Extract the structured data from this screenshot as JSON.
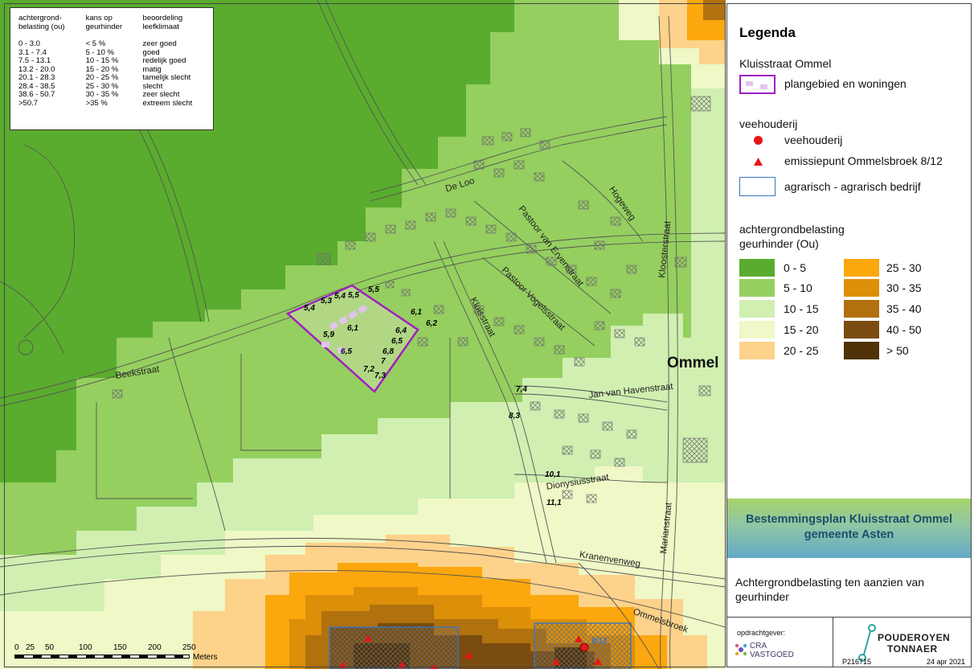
{
  "class_table": {
    "headers": [
      "achtergrond-\nbelasting (ou)",
      "kans op\ngeurhinder",
      "beoordeling\nleefklimaat"
    ],
    "rows": [
      [
        "0 - 3.0",
        "< 5 %",
        "zeer goed"
      ],
      [
        "3.1 - 7.4",
        "5 - 10 %",
        "goed"
      ],
      [
        "7.5 - 13.1",
        "10 - 15 %",
        "redelijk goed"
      ],
      [
        "13.2 - 20.0",
        "15 - 20 %",
        "matig"
      ],
      [
        "20.1 - 28.3",
        "20 - 25 %",
        "tamelijk slecht"
      ],
      [
        "28.4 - 38.5",
        "25 - 30 %",
        "slecht"
      ],
      [
        "38.6 - 50.7",
        "30 - 35 %",
        "zeer slecht"
      ],
      [
        ">50.7",
        ">35  %",
        "extreem slecht"
      ]
    ]
  },
  "streets": {
    "de_loo": "De Loo",
    "pastoor_van_erven": "Pastoor van Ervenstraat",
    "hogeweg": "Hogeweg",
    "kloosterstraat": "Kloosterstraat",
    "pastoor_vogels": "Pastoor Vogelsstraat",
    "kluisstraat": "Kluisstraat",
    "beekstraat": "Beekstraat",
    "jan_van_haven": "Jan van Havenstraat",
    "dionysius": "Dionysiusstraat",
    "kranenven": "Kranenvenweg",
    "ommelsbroek": "Ommelsbroek",
    "marian": "Marianstraat"
  },
  "town": "Ommel",
  "values": {
    "v55": "5,5",
    "v53": "5,3",
    "v54a": "5,4",
    "v54b": "5,4",
    "v55b": "5,5",
    "v61a": "6,1",
    "v62": "6,2",
    "v61b": "6,1",
    "v59": "5,9",
    "v64": "6,4",
    "v65a": "6,5",
    "v68": "6,8",
    "v65b": "6,5",
    "v7": "7",
    "v72": "7,2",
    "v73": "7,3",
    "v74": "7,4",
    "v83": "8,3",
    "v101": "10,1",
    "v111": "11,1"
  },
  "scale": {
    "ticks": [
      "0",
      "25",
      "50",
      "100",
      "150",
      "200",
      "250"
    ],
    "unit": "Meters"
  },
  "legend": {
    "title": "Legenda",
    "group1": "Kluisstraat Ommel",
    "plan_label": "plangebied en woningen",
    "group2": "veehouderij",
    "veehouderij_label": "veehouderij",
    "emissie_label": "emissiepunt Ommelsbroek 8/12",
    "agrarisch_label": "agrarisch - agrarisch bedrijf",
    "group3_line1": "achtergrondbelasting",
    "group3_line2": "geurhinder (Ou)",
    "classes": [
      {
        "label": "0 - 5",
        "color": "#5aac2e"
      },
      {
        "label": "5 - 10",
        "color": "#95cf5f"
      },
      {
        "label": "10 - 15",
        "color": "#d0efb1"
      },
      {
        "label": "15 - 20",
        "color": "#eff8c6"
      },
      {
        "label": "20 - 25",
        "color": "#fdd28a"
      },
      {
        "label": "25 - 30",
        "color": "#fba70d"
      },
      {
        "label": "30 - 35",
        "color": "#dc8f09"
      },
      {
        "label": "35 - 40",
        "color": "#b0710e"
      },
      {
        "label": "40 - 50",
        "color": "#7a4c10"
      },
      {
        "label": "> 50",
        "color": "#4f3207"
      }
    ],
    "colors": {
      "plan_outline": "#a020c0",
      "plan_fill": "#e2c4ee",
      "point": "#e61717",
      "agrarisch": "#3a76c0"
    }
  },
  "plan_title_line1": "Bestemmingsplan Kluisstraat Ommel",
  "plan_title_line2": "gemeente Asten",
  "description": "Achtergrondbelasting ten aanzien van geurhinder",
  "footer": {
    "opdrachtgever": "opdrachtgever:",
    "client_line1": "CRA",
    "client_line2": "VASTGOED",
    "consultant_line1": "POUDEROYEN",
    "consultant_line2": "TONNAER",
    "project_no": "P216715",
    "date": "24 apr 2021"
  }
}
